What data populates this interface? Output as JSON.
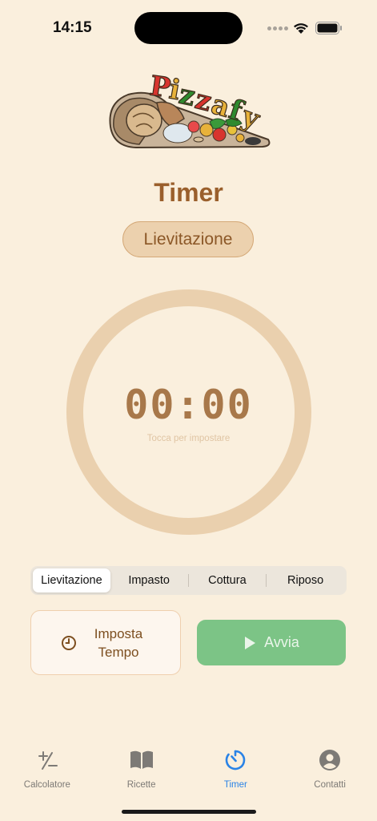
{
  "status_bar": {
    "time": "14:15"
  },
  "logo": {
    "text": "Pizzafy"
  },
  "header": {
    "title": "Timer"
  },
  "mode_chip": {
    "label": "Lievitazione"
  },
  "timer": {
    "display": "00:00",
    "hint": "Tocca per impostare"
  },
  "segments": {
    "items": [
      "Lievitazione",
      "Impasto",
      "Cottura",
      "Riposo"
    ],
    "selected": "Lievitazione"
  },
  "actions": {
    "set_time_label": "Imposta Tempo",
    "start_label": "Avvia"
  },
  "tabbar": {
    "items": [
      {
        "label": "Calcolatore",
        "icon": "plus-minus-icon"
      },
      {
        "label": "Ricette",
        "icon": "book-icon"
      },
      {
        "label": "Timer",
        "icon": "timer-icon"
      },
      {
        "label": "Contatti",
        "icon": "person-circle-icon"
      }
    ],
    "active": "Timer"
  },
  "colors": {
    "background": "#faefdd",
    "accent_brown": "#9a5f2c",
    "ring": "#ead0ae",
    "start_button": "#7cc486",
    "tab_active": "#2a83e6"
  }
}
